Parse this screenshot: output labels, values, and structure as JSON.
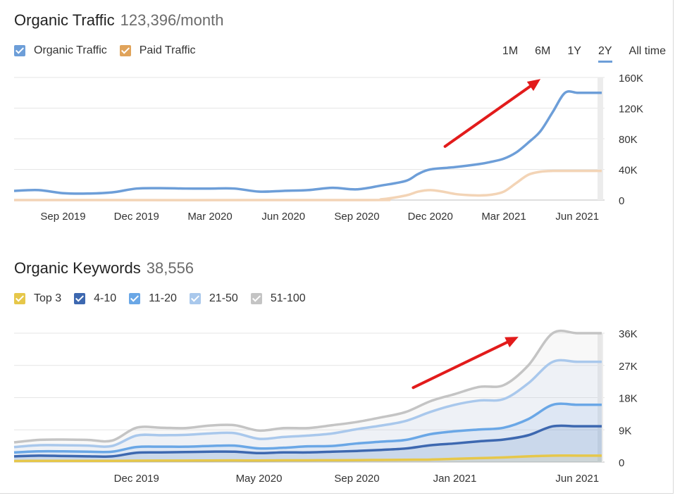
{
  "traffic": {
    "title": "Organic Traffic",
    "value": "123,396/month",
    "legend": [
      {
        "label": "Organic Traffic",
        "color": "#6d9ed8"
      },
      {
        "label": "Paid Traffic",
        "color": "#e0a35a"
      }
    ],
    "ranges": [
      "1M",
      "6M",
      "1Y",
      "2Y",
      "All time"
    ],
    "active_range": "2Y"
  },
  "keywords": {
    "title": "Organic Keywords",
    "value": "38,556",
    "legend": [
      {
        "label": "Top 3",
        "color": "#e6c74a"
      },
      {
        "label": "4-10",
        "color": "#3d68b0"
      },
      {
        "label": "11-20",
        "color": "#6aa7e6"
      },
      {
        "label": "21-50",
        "color": "#a9c8ec"
      },
      {
        "label": "51-100",
        "color": "#c4c4c4"
      }
    ]
  },
  "chart_data": [
    {
      "type": "line",
      "title": "Organic Traffic",
      "ylim": [
        0,
        160000
      ],
      "yticks": [
        0,
        40000,
        80000,
        120000,
        160000
      ],
      "ytick_labels": [
        "0",
        "40K",
        "80K",
        "120K",
        "160K"
      ],
      "xlim": [
        0,
        24
      ],
      "xticks": [
        {
          "x": 2,
          "label": "Sep 2019"
        },
        {
          "x": 5,
          "label": "Dec 2019"
        },
        {
          "x": 8,
          "label": "Mar 2020"
        },
        {
          "x": 11,
          "label": "Jun 2020"
        },
        {
          "x": 14,
          "label": "Sep 2020"
        },
        {
          "x": 17,
          "label": "Dec 2020"
        },
        {
          "x": 20,
          "label": "Mar 2021"
        },
        {
          "x": 23,
          "label": "Jun 2021"
        }
      ],
      "grid": true,
      "series": [
        {
          "name": "Organic Traffic",
          "color": "#6d9ed8",
          "x": [
            0,
            1,
            2,
            3,
            4,
            5,
            6,
            7,
            8,
            9,
            10,
            11,
            12,
            13,
            14,
            15,
            16,
            16.5,
            17,
            18,
            19,
            19.5,
            20,
            20.5,
            21,
            21.5,
            22,
            22.5,
            23,
            23.5,
            24
          ],
          "values": [
            12000,
            13000,
            9000,
            8500,
            10000,
            15000,
            15500,
            15000,
            15000,
            15000,
            11000,
            12000,
            13000,
            16000,
            14000,
            19000,
            25000,
            34000,
            40000,
            43000,
            47000,
            50000,
            54000,
            62000,
            75000,
            90000,
            115000,
            140000,
            140000,
            140000,
            140000
          ]
        },
        {
          "name": "Paid Traffic",
          "color": "#f3d4b6",
          "x": [
            0,
            14,
            15,
            16,
            16.5,
            17,
            17.5,
            18,
            18.5,
            19,
            19.5,
            20,
            20.5,
            21,
            21.5,
            22,
            23,
            24
          ],
          "values": [
            0,
            0,
            1000,
            6000,
            11000,
            13000,
            11000,
            8000,
            6500,
            6000,
            7000,
            11000,
            22000,
            33000,
            37000,
            38000,
            38000,
            38000
          ]
        }
      ]
    },
    {
      "type": "area",
      "title": "Organic Keywords",
      "ylim": [
        0,
        36000
      ],
      "yticks": [
        0,
        9000,
        18000,
        27000,
        36000
      ],
      "ytick_labels": [
        "0",
        "9K",
        "18K",
        "27K",
        "36K"
      ],
      "xlim": [
        0,
        24
      ],
      "xticks": [
        {
          "x": 5,
          "label": "Dec 2019"
        },
        {
          "x": 10,
          "label": "May 2020"
        },
        {
          "x": 14,
          "label": "Sep 2020"
        },
        {
          "x": 18,
          "label": "Jan 2021"
        },
        {
          "x": 23,
          "label": "Jun 2021"
        }
      ],
      "grid": true,
      "x": [
        0,
        1,
        2,
        3,
        4,
        5,
        6,
        7,
        8,
        9,
        10,
        11,
        12,
        13,
        14,
        15,
        16,
        17,
        18,
        19,
        20,
        21,
        22,
        23,
        24
      ],
      "series": [
        {
          "name": "51-100",
          "color": "#c4c4c4",
          "values": [
            5500,
            6200,
            6300,
            6200,
            6000,
            9600,
            9600,
            9500,
            10200,
            10300,
            8800,
            9500,
            9500,
            10300,
            11200,
            12500,
            14000,
            17000,
            19000,
            21000,
            21500,
            27000,
            36000,
            36000,
            36000
          ]
        },
        {
          "name": "21-50",
          "color": "#a9c8ec",
          "values": [
            4200,
            4700,
            4700,
            4600,
            4500,
            7400,
            7500,
            7600,
            8000,
            8100,
            6500,
            7000,
            7400,
            8000,
            9200,
            10200,
            11500,
            14000,
            16000,
            17200,
            17600,
            22000,
            28000,
            28000,
            28000
          ]
        },
        {
          "name": "11-20",
          "color": "#6aa7e6",
          "values": [
            2700,
            3000,
            3000,
            2900,
            2900,
            4200,
            4300,
            4300,
            4500,
            4600,
            3800,
            4000,
            4400,
            4500,
            5200,
            5700,
            6200,
            7800,
            8600,
            9100,
            9600,
            12000,
            16000,
            16000,
            16000
          ]
        },
        {
          "name": "4-10",
          "color": "#3d68b0",
          "values": [
            1600,
            1800,
            1700,
            1600,
            1600,
            2600,
            2700,
            2800,
            2900,
            2900,
            2500,
            2700,
            2700,
            2900,
            3100,
            3400,
            3800,
            4700,
            5200,
            5800,
            6300,
            7500,
            10000,
            10000,
            10000
          ]
        },
        {
          "name": "Top 3",
          "color": "#e6c74a",
          "values": [
            300,
            350,
            350,
            350,
            350,
            400,
            420,
            430,
            450,
            460,
            450,
            480,
            500,
            520,
            550,
            600,
            650,
            700,
            900,
            1100,
            1300,
            1600,
            1800,
            1800,
            1800
          ]
        }
      ]
    }
  ]
}
